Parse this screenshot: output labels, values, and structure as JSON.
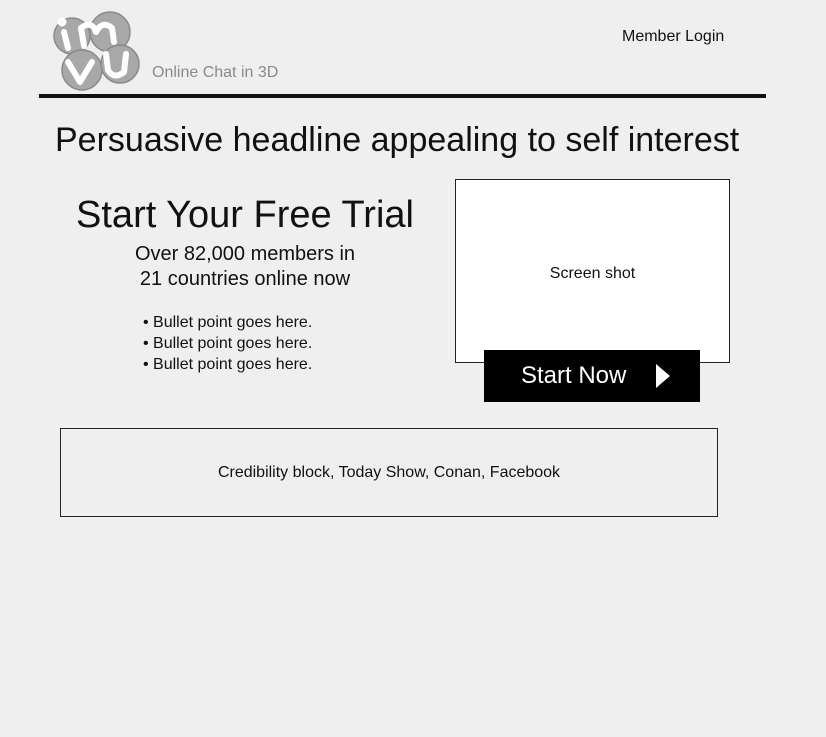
{
  "header": {
    "logo_text": "imvu",
    "tagline": "Online Chat in 3D",
    "member_login": "Member Login"
  },
  "main": {
    "headline": "Persuasive headline appealing to self interest",
    "trial": {
      "title": "Start Your Free Trial",
      "members_line1": "Over 82,000 members in",
      "members_line2": "21 countries online now",
      "bullets": [
        "• Bullet point goes here.",
        "• Bullet point goes here.",
        "• Bullet point goes here."
      ]
    },
    "screenshot": {
      "label": "Screen shot"
    },
    "cta": {
      "label": "Start Now",
      "icon": "play-arrow-icon"
    }
  },
  "credibility": {
    "text": "Credibility block, Today Show, Conan, Facebook"
  },
  "colors": {
    "background": "#efefef",
    "text": "#111111",
    "tagline": "#8a8a8a",
    "button_bg": "#000000",
    "button_text": "#ffffff",
    "logo_gray": "#a6a6a6"
  }
}
